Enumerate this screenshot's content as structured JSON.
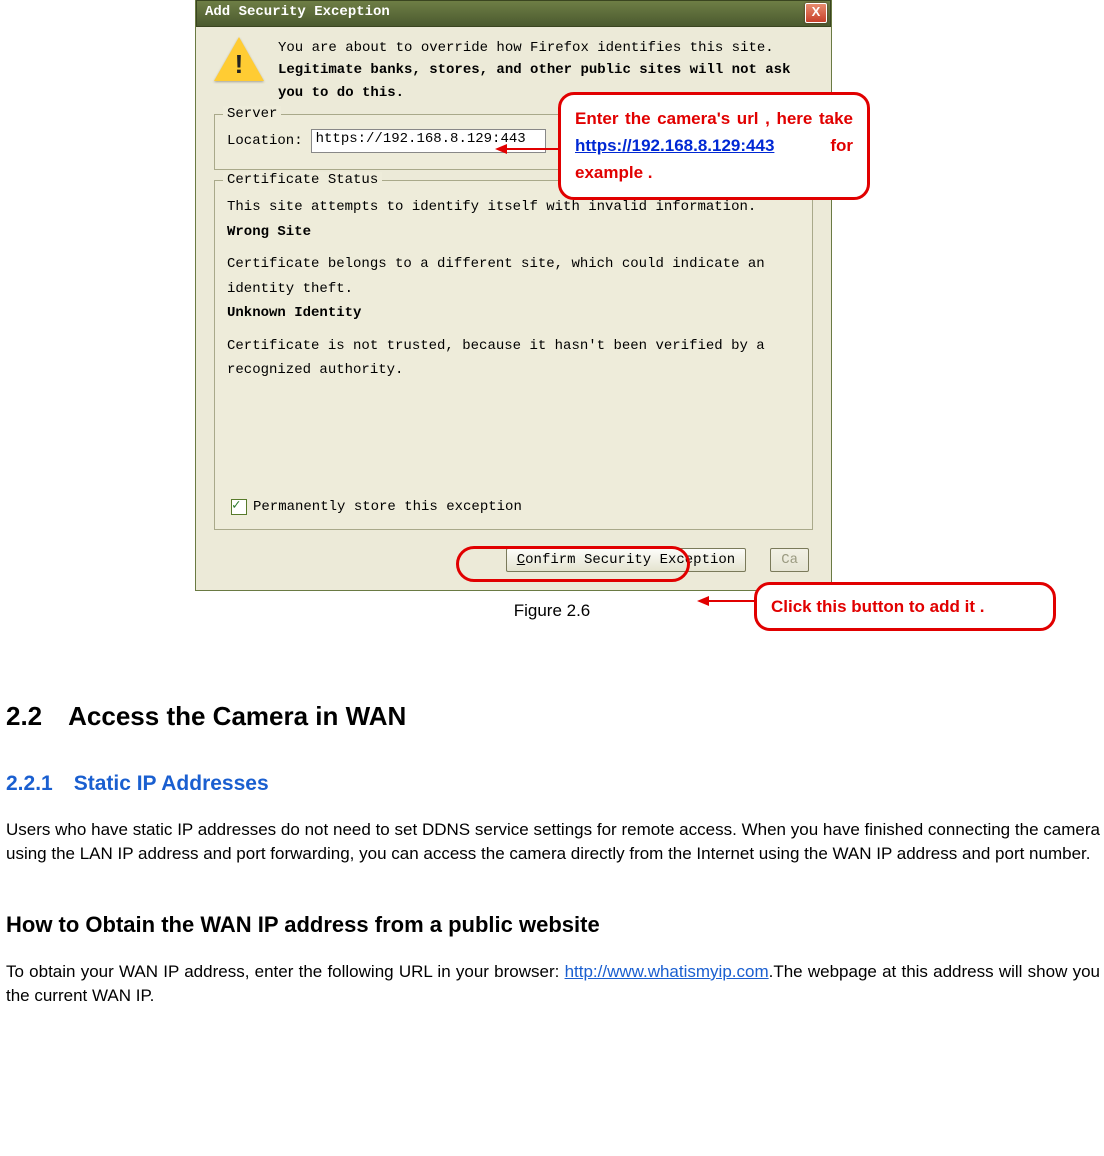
{
  "dialog": {
    "title": "Add Security Exception",
    "intro_line1": "You are about to override how Firefox identifies this site.",
    "intro_line2": "Legitimate banks, stores, and other public sites will not ask you to do this.",
    "server": {
      "legend": "Server",
      "location_label": "Location:",
      "location_value": "https://192.168.8.129:443"
    },
    "cert": {
      "legend": "Certificate Status",
      "line1": "This site attempts to identify itself with invalid information.",
      "wrong_site_heading": "Wrong Site",
      "wrong_site_text": "Certificate belongs to a different site, which could indicate an identity theft.",
      "unknown_heading": "Unknown Identity",
      "unknown_text": "Certificate is not trusted, because it hasn't been verified by a recognized authority."
    },
    "perm_label": "Permanently store this exception",
    "confirm_btn": "Confirm Security Exception",
    "cancel_btn": "Ca"
  },
  "callouts": {
    "c1_part1": "Enter the camera's url , here take ",
    "c1_url": "https://192.168.8.129:443",
    "c1_part2": " for example .",
    "c2": "Click this button to add it ."
  },
  "figure_caption": "Figure 2.6",
  "doc": {
    "h22": "2.2 Access the Camera in WAN",
    "h221": "2.2.1 Static IP Addresses",
    "p1": "Users who have static IP addresses do not need to set DDNS service settings for remote access. When you have finished connecting the camera using the LAN IP address and port forwarding, you can access the camera directly from the Internet using the WAN IP address and port number.",
    "h_obtain": "How to Obtain the WAN IP address from a public website",
    "p2_a": "To obtain your WAN IP address, enter the following URL in your browser: ",
    "p2_link": "http://www.whatismyip.com",
    "p2_b": ".The webpage at this address will show you the current WAN IP."
  }
}
